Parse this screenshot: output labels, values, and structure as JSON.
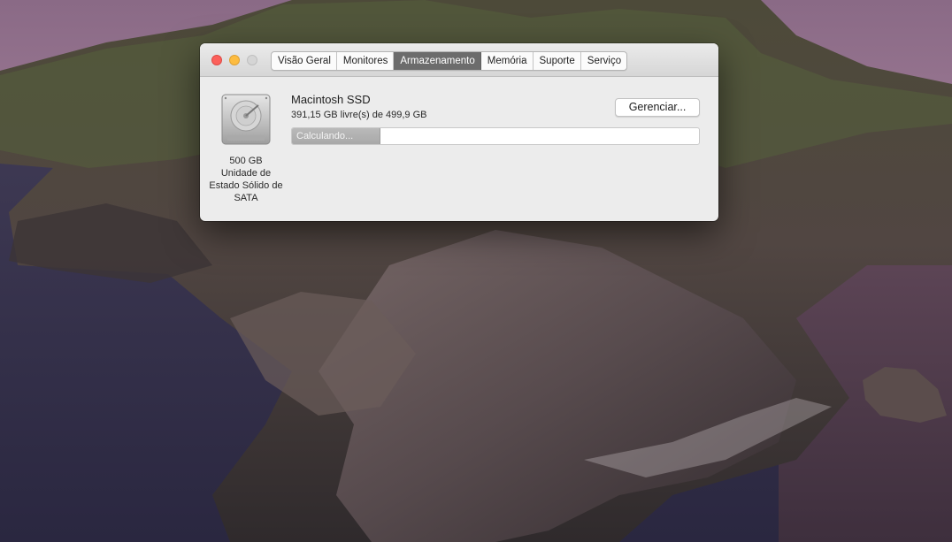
{
  "window": {
    "tabs": [
      {
        "label": "Visão Geral",
        "active": false
      },
      {
        "label": "Monitores",
        "active": false
      },
      {
        "label": "Armazenamento",
        "active": true
      },
      {
        "label": "Memória",
        "active": false
      },
      {
        "label": "Suporte",
        "active": false
      },
      {
        "label": "Serviço",
        "active": false
      }
    ],
    "traffic_lights": [
      "close",
      "minimize",
      "zoom"
    ]
  },
  "drive": {
    "icon": "internal-drive-icon",
    "capacity": "500 GB",
    "type_line_1": "Unidade de",
    "type_line_2": "Estado Sólido de",
    "type_line_3": "SATA"
  },
  "disk": {
    "name": "Macintosh SSD",
    "free": "391,15 GB livre(s) de 499,9 GB",
    "bar_label": "Calculando...",
    "bar_fraction": 0.217
  },
  "manage_button": {
    "label": "Gerenciar..."
  },
  "colors": {
    "close": "#fc605b",
    "minimize": "#fdbc40",
    "active_tab": "#6c6c6c",
    "bar_segment": "#b0b0b0"
  }
}
